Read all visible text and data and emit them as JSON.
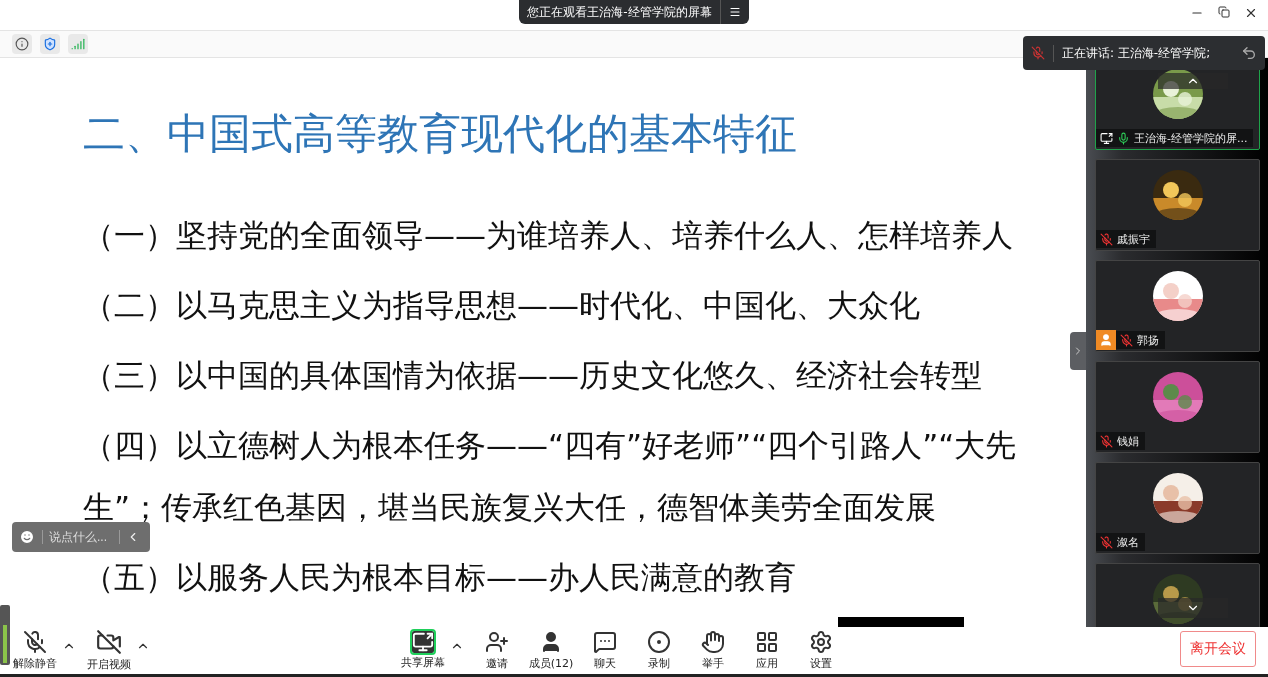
{
  "top_bar": {
    "sharing_banner": "您正在观看王治海-经管学院的屏幕"
  },
  "speaker": {
    "label": "正在讲话: 王治海-经管学院;",
    "muted": true
  },
  "slide": {
    "title": "二、中国式高等教育现代化的基本特征",
    "items": [
      "（一）坚持党的全面领导——为谁培养人、培养什么人、怎样培养人",
      "（二）以马克思主义为指导思想——时代化、中国化、大众化",
      "（三）以中国的具体国情为依据——历史文化悠久、经济社会转型",
      "（四）以立德树人为根本任务——“四有”好老师”“四个引路人”“大先生”；传承红色基因，堪当民族复兴大任，德智体美劳全面发展",
      "（五）以服务人民为根本目标——办人民满意的教育"
    ]
  },
  "chat": {
    "placeholder": "说点什么..."
  },
  "participants": [
    {
      "name": "王治海-经管学院的屏...",
      "muted": false,
      "sharing": true,
      "selected": true,
      "host_badge": false
    },
    {
      "name": "戚振宇",
      "muted": true,
      "sharing": false,
      "selected": false,
      "host_badge": false
    },
    {
      "name": "郭扬",
      "muted": true,
      "sharing": false,
      "selected": false,
      "host_badge": true
    },
    {
      "name": "钱娟",
      "muted": true,
      "sharing": false,
      "selected": false,
      "host_badge": false
    },
    {
      "name": "溆名",
      "muted": true,
      "sharing": false,
      "selected": false,
      "host_badge": false
    },
    {
      "selected": false
    }
  ],
  "toolbar": [
    {
      "kind": "mic",
      "label": "解除静音",
      "muted": true,
      "caret": true
    },
    {
      "kind": "video",
      "label": "开启视频",
      "muted": true,
      "caret": true
    },
    {
      "kind": "share",
      "label": "共享屏幕",
      "active": true,
      "caret": true
    },
    {
      "kind": "invite",
      "label": "邀请",
      "caret": false
    },
    {
      "kind": "members",
      "label": "成员(12)",
      "caret": false
    },
    {
      "kind": "chat",
      "label": "聊天",
      "caret": false
    },
    {
      "kind": "record",
      "label": "录制",
      "caret": false
    },
    {
      "kind": "hand",
      "label": "举手",
      "caret": false
    },
    {
      "kind": "apps",
      "label": "应用",
      "caret": false
    },
    {
      "kind": "settings",
      "label": "设置",
      "caret": false
    }
  ],
  "leave_button": "离开会议"
}
